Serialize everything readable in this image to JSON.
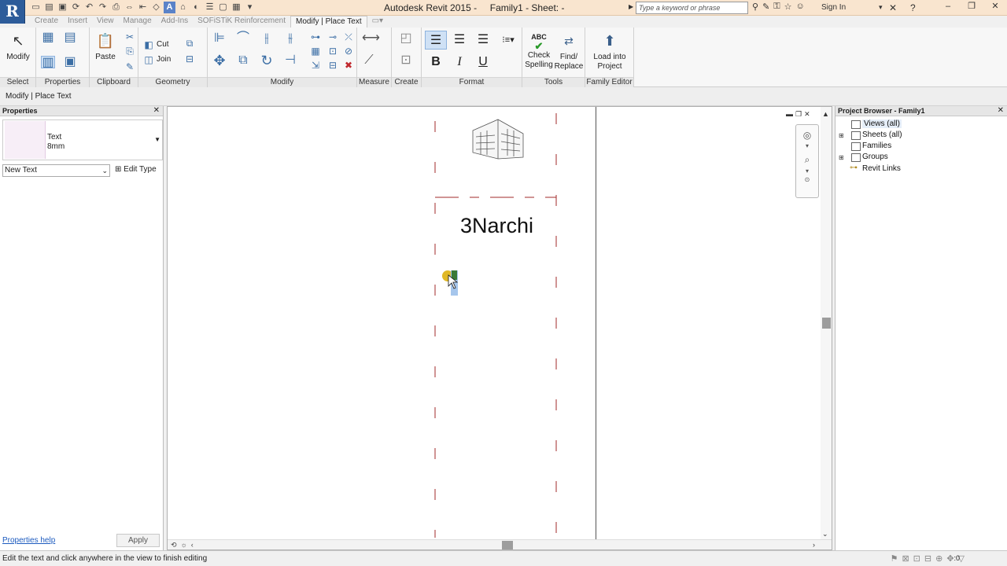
{
  "titlebar": {
    "app_letter": "R",
    "app_name": "Autodesk Revit 2015 -",
    "doc_name": "Family1 - Sheet: -",
    "search_placeholder": "Type a keyword or phrase",
    "signin": "Sign In",
    "text_tool_glyph": "A"
  },
  "tabs": [
    {
      "label": "Create",
      "active": false
    },
    {
      "label": "Insert",
      "active": false
    },
    {
      "label": "View",
      "active": false
    },
    {
      "label": "Manage",
      "active": false
    },
    {
      "label": "Add-Ins",
      "active": false
    },
    {
      "label": "SOFiSTiK Reinforcement",
      "active": false
    },
    {
      "label": "Modify | Place Text",
      "active": true
    }
  ],
  "ribbon": {
    "select": {
      "button": "Modify",
      "label": "Select"
    },
    "properties": {
      "label": "Properties"
    },
    "clipboard": {
      "paste": "Paste",
      "cut": "Cut",
      "join": "Join",
      "label": "Clipboard"
    },
    "geometry": {
      "label": "Geometry"
    },
    "modify": {
      "label": "Modify"
    },
    "measure": {
      "label": "Measure"
    },
    "create": {
      "label": "Create"
    },
    "format": {
      "label": "Format",
      "bold": "B",
      "italic": "I",
      "underline": "U"
    },
    "tools": {
      "check_line1": "Check",
      "check_line2": "Spelling",
      "find_line1": "Find/",
      "find_line2": "Replace",
      "check_icon_text": "ABC",
      "label": "Tools"
    },
    "family_editor": {
      "load_line1": "Load into",
      "load_line2": "Project",
      "label": "Family Editor"
    }
  },
  "options_bar": {
    "text": "Modify | Place Text"
  },
  "properties": {
    "title": "Properties",
    "type_name_line1": "Text",
    "type_name_line2": "8mm",
    "instance_dropdown": "New Text",
    "edit_type": "Edit Type",
    "help_link": "Properties help",
    "apply": "Apply"
  },
  "canvas": {
    "sheet_text": "3Narchi"
  },
  "project_browser": {
    "title": "Project Browser - Family1",
    "items": [
      {
        "label": "Views (all)"
      },
      {
        "label": "Sheets (all)"
      },
      {
        "label": "Families"
      },
      {
        "label": "Groups"
      },
      {
        "label": "Revit Links"
      }
    ]
  },
  "status_bar": {
    "message": "Edit the text and click anywhere in the view to finish editing",
    "zoom_readout": ":0"
  },
  "colors": {
    "titlebar": "#f9e5cf",
    "app_button": "#2d5c9a",
    "crop_lines": "#a22a2a",
    "link": "#1d5bbf"
  }
}
